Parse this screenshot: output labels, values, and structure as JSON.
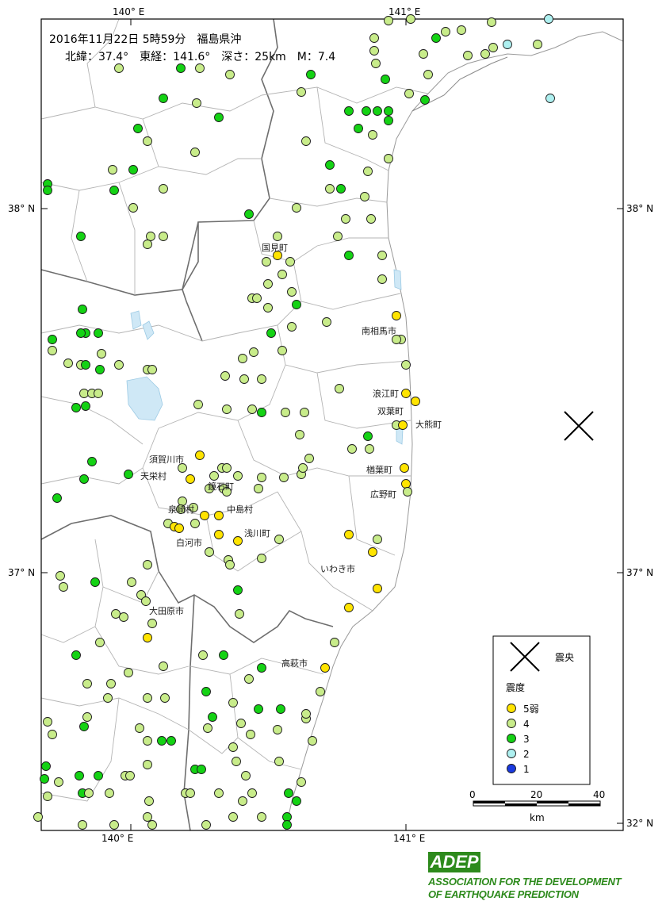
{
  "header": {
    "line1": "2016年11月22日 5時59分　福島県沖",
    "line2": "北緯：37.4°　東経：141.6°　深さ：25km　M：7.4"
  },
  "axes": {
    "top_left": "140° E",
    "top_right": "141° E",
    "bottom_left": "140° E",
    "bottom_right": "141° E",
    "left_top": "38° N",
    "left_bottom": "37° N",
    "right_top": "38° N",
    "right_bottom": "37° N",
    "right_corner": "32° N"
  },
  "places": [
    {
      "name": "国見町"
    },
    {
      "name": "南相馬市"
    },
    {
      "name": "浪江町"
    },
    {
      "name": "双葉町"
    },
    {
      "name": "大熊町"
    },
    {
      "name": "須賀川市"
    },
    {
      "name": "天栄村"
    },
    {
      "name": "鏡石町"
    },
    {
      "name": "楢葉町"
    },
    {
      "name": "広野町"
    },
    {
      "name": "泉崎村"
    },
    {
      "name": "中島村"
    },
    {
      "name": "浅川町"
    },
    {
      "name": "白河市"
    },
    {
      "name": "いわき市"
    },
    {
      "name": "大田原市"
    },
    {
      "name": "高萩市"
    }
  ],
  "legend": {
    "epicenter_label": "震央",
    "intensity_title": "震度",
    "items": [
      {
        "label": "5弱",
        "color": "#ffe400"
      },
      {
        "label": "4",
        "color": "#c8ec8a"
      },
      {
        "label": "3",
        "color": "#14d214"
      },
      {
        "label": "2",
        "color": "#aef0f0"
      },
      {
        "label": "1",
        "color": "#1a3ae0"
      }
    ]
  },
  "scale": {
    "labels": [
      "0",
      "20",
      "40"
    ],
    "unit": "km"
  },
  "logo": {
    "name": "ADEP",
    "line1": "ASSOCIATION FOR THE DEVELOPMENT",
    "line2": "OF EARTHQUAKE PREDICTION"
  }
}
